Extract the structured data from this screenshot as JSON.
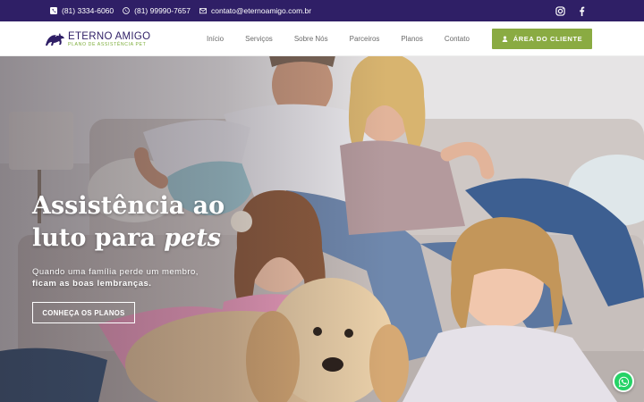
{
  "topbar": {
    "phone_1": "(81) 3334-6060",
    "phone_2": "(81) 99990-7657",
    "email": "contato@eternoamigo.com.br",
    "social": [
      "instagram-icon",
      "facebook-icon"
    ]
  },
  "brand": {
    "name": "ETERNO AMIGO",
    "tagline": "PLANO DE ASSISTÊNCIA PET"
  },
  "nav": {
    "items": [
      "Início",
      "Serviços",
      "Sobre Nós",
      "Parceiros",
      "Planos",
      "Contato"
    ]
  },
  "header": {
    "client_area_label": "ÁREA DO CLIENTE"
  },
  "hero": {
    "title_line1": "Assistência ao",
    "title_line2_a": "luto para ",
    "title_line2_b": "pets",
    "subtitle_line1": "Quando uma família perde um membro,",
    "subtitle_line2": "ficam as boas lembranças.",
    "cta_label": "CONHEÇA OS PLANOS"
  },
  "colors": {
    "topbar_bg": "#2f1f66",
    "brand_primary": "#2f1f66",
    "accent_green": "#8aab42",
    "whatsapp": "#25d366"
  }
}
